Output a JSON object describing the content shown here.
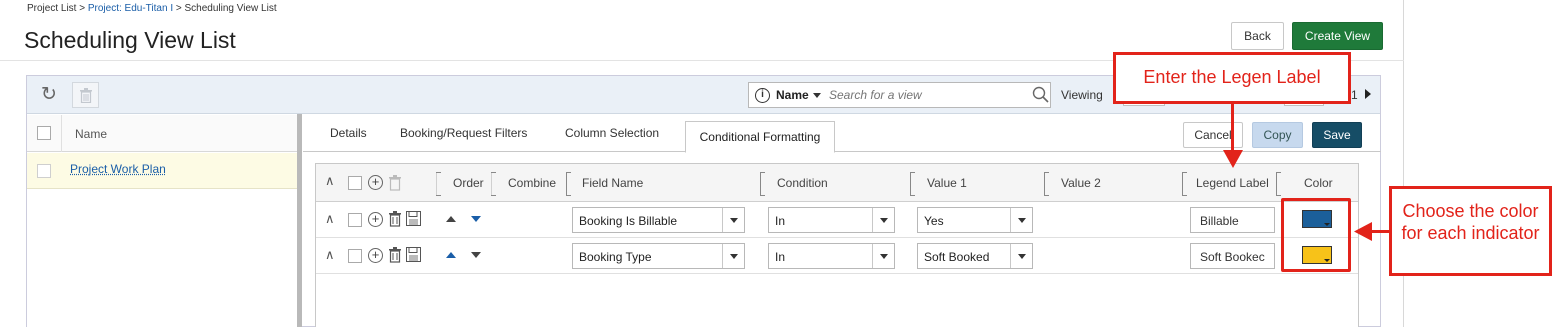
{
  "breadcrumb": {
    "root": "Project List",
    "separator": " > ",
    "project": "Project: Edu-Titan I",
    "current": "Scheduling View List"
  },
  "page_title": "Scheduling View List",
  "header_buttons": {
    "back": "Back",
    "create_view": "Create View"
  },
  "toolbar": {
    "search_field": "Name",
    "search_placeholder": "Search for a view",
    "viewing_label": "Viewing",
    "page_count": "1"
  },
  "view_list": {
    "column_header": "Name",
    "items": [
      {
        "name": "Project Work Plan"
      }
    ]
  },
  "tabs": [
    {
      "label": "Details"
    },
    {
      "label": "Booking/Request Filters"
    },
    {
      "label": "Column Selection"
    },
    {
      "label": "Conditional Formatting"
    }
  ],
  "action_buttons": {
    "cancel": "Cancel",
    "copy": "Copy",
    "save": "Save"
  },
  "grid": {
    "headers": {
      "order": "Order",
      "combine": "Combine",
      "field_name": "Field Name",
      "condition": "Condition",
      "value1": "Value 1",
      "value2": "Value 2",
      "legend_label": "Legend Label",
      "color": "Color"
    },
    "rows": [
      {
        "field_name": "Booking Is Billable",
        "condition": "In",
        "value1": "Yes",
        "legend_label": "Billable",
        "color": "#1b5f9a"
      },
      {
        "field_name": "Booking Type",
        "condition": "In",
        "value1": "Soft Booked",
        "legend_label": "Soft Bookec",
        "color": "#f7c219"
      }
    ]
  },
  "annotations": {
    "legend_callout": "Enter the Legen Label",
    "color_callout": "Choose the color for each indicator",
    "accent": "#e2231a"
  }
}
